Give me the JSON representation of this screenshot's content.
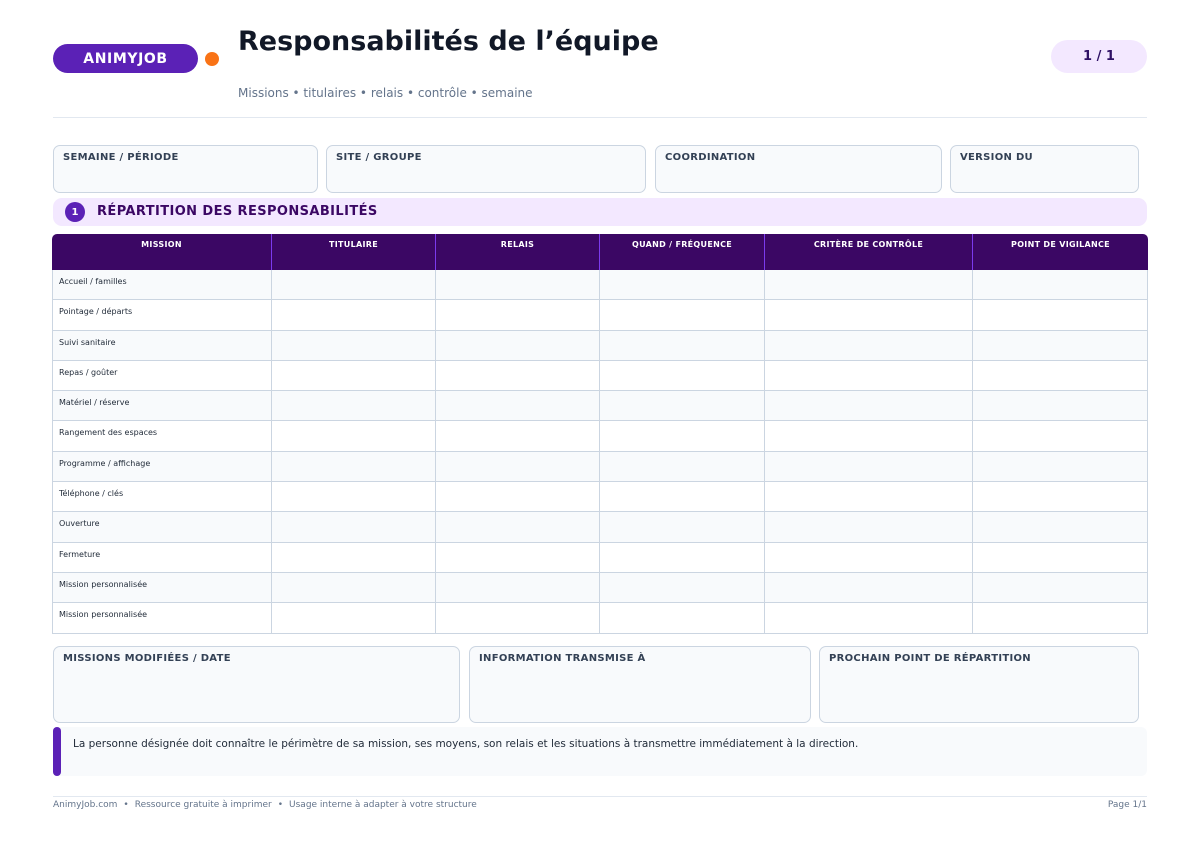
{
  "header": {
    "brand": "ANIMYJOB",
    "title": "Responsabilités de l’équipe",
    "subtitle": "Missions • titulaires • relais • contrôle • semaine",
    "page_indicator": "1 / 1"
  },
  "info_fields": [
    {
      "label": "SEMAINE / PÉRIODE",
      "value": ""
    },
    {
      "label": "SITE / GROUPE",
      "value": ""
    },
    {
      "label": "COORDINATION",
      "value": ""
    },
    {
      "label": "VERSION DU",
      "value": ""
    }
  ],
  "section": {
    "number": "1",
    "title": "RÉPARTITION DES RESPONSABILITÉS"
  },
  "table": {
    "columns": [
      "MISSION",
      "TITULAIRE",
      "RELAIS",
      "QUAND / FRÉQUENCE",
      "CRITÈRE DE CONTRÔLE",
      "POINT DE VIGILANCE"
    ],
    "rows": [
      "Accueil / familles",
      "Pointage / départs",
      "Suivi sanitaire",
      "Repas / goûter",
      "Matériel / réserve",
      "Rangement des espaces",
      "Programme / affichage",
      "Téléphone / clés",
      "Ouverture",
      "Fermeture",
      "Mission personnalisée",
      "Mission personnalisée"
    ]
  },
  "bottom_fields": [
    {
      "label": "MISSIONS MODIFIÉES / DATE",
      "value": ""
    },
    {
      "label": "INFORMATION TRANSMISE À",
      "value": ""
    },
    {
      "label": "PROCHAIN POINT DE RÉPARTITION",
      "value": ""
    }
  ],
  "note": "La personne désignée doit connaître le périmètre de sa mission, ses moyens, son relais et les situations à transmettre immédiatement à la direction.",
  "footer": {
    "site": "AnimyJob.com",
    "resource": "Ressource gratuite à imprimer",
    "usage": "Usage interne à adapter à votre structure",
    "page": "Page 1/1"
  },
  "colors": {
    "brand": "#5b21b6",
    "accent": "#f97316",
    "header_bg": "#3b0764",
    "band_bg": "#f3e8ff"
  }
}
